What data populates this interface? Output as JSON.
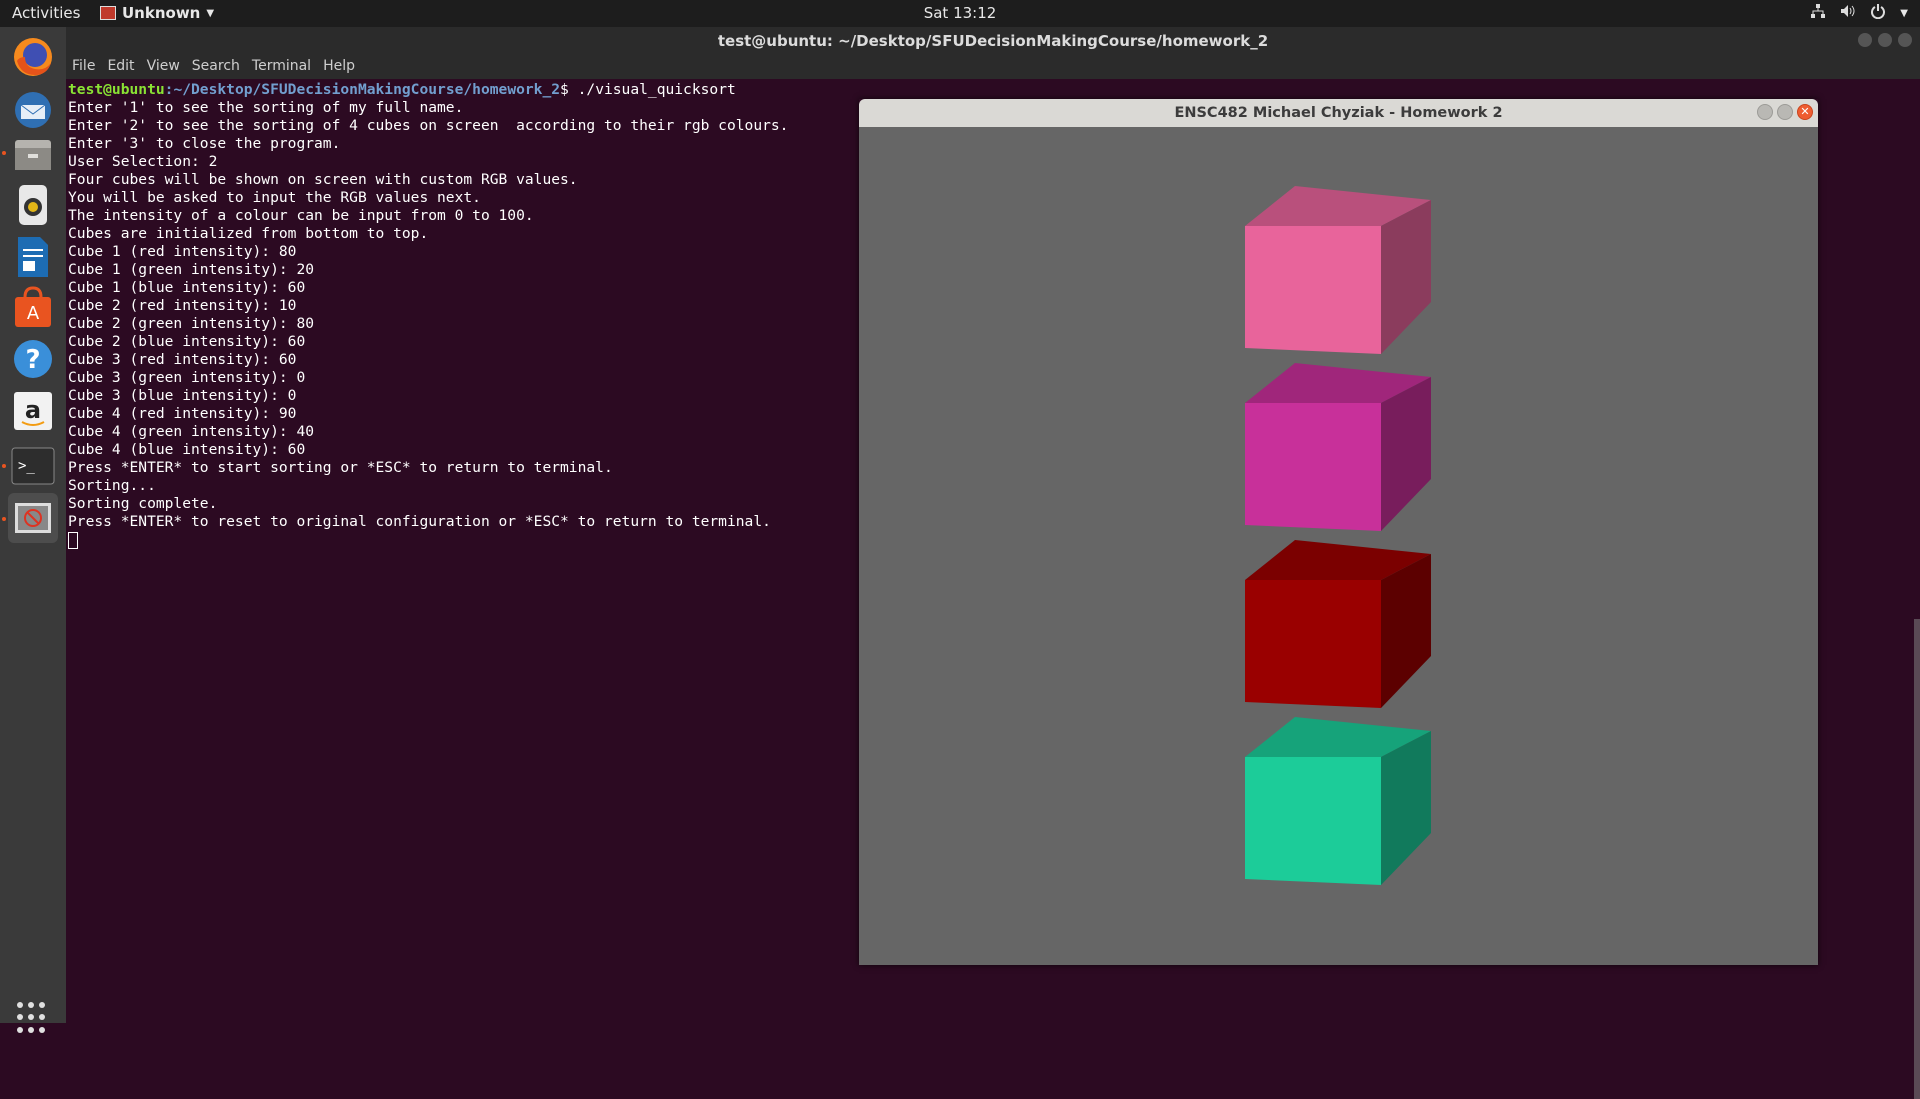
{
  "topbar": {
    "activities": "Activities",
    "app_menu": "Unknown",
    "clock": "Sat 13:12",
    "tray_icons": [
      "network-icon",
      "volume-icon",
      "power-icon"
    ]
  },
  "dock": {
    "items": [
      "firefox-icon",
      "thunderbird-icon",
      "files-icon",
      "rhythmbox-icon",
      "writer-icon",
      "software-icon",
      "help-icon",
      "amazon-icon",
      "terminal-icon",
      "app-icon"
    ]
  },
  "terminal": {
    "title": "test@ubuntu: ~/Desktop/SFUDecisionMakingCourse/homework_2",
    "menu": [
      "File",
      "Edit",
      "View",
      "Search",
      "Terminal",
      "Help"
    ],
    "prompt_user": "test@ubuntu",
    "prompt_path": ":~/Desktop/SFUDecisionMakingCourse/homework_2",
    "command": "$ ./visual_quicksort",
    "lines": [
      "Enter '1' to see the sorting of my full name.",
      "Enter '2' to see the sorting of 4 cubes on screen  according to their rgb colours.",
      "Enter '3' to close the program.",
      "User Selection: 2",
      "Four cubes will be shown on screen with custom RGB values.",
      "You will be asked to input the RGB values next.",
      "The intensity of a colour can be input from 0 to 100.",
      "Cubes are initialized from bottom to top.",
      "Cube 1 (red intensity): 80",
      "Cube 1 (green intensity): 20",
      "Cube 1 (blue intensity): 60",
      "Cube 2 (red intensity): 10",
      "Cube 2 (green intensity): 80",
      "Cube 2 (blue intensity): 60",
      "Cube 3 (red intensity): 60",
      "Cube 3 (green intensity): 0",
      "Cube 3 (blue intensity): 0",
      "Cube 4 (red intensity): 90",
      "Cube 4 (green intensity): 40",
      "Cube 4 (blue intensity): 60",
      "Press *ENTER* to start sorting or *ESC* to return to terminal.",
      "Sorting...",
      "Sorting complete.",
      "Press *ENTER* to reset to original configuration or *ESC* to return to terminal."
    ]
  },
  "gl_window": {
    "title": "ENSC482 Michael Chyziak - Homework 2",
    "background": "#666666",
    "cubes": [
      {
        "front": "#e8649b",
        "top": "#b9507c",
        "side": "#8b3c5d"
      },
      {
        "front": "#c8309a",
        "top": "#a0267b",
        "side": "#781d5c"
      },
      {
        "front": "#9a0000",
        "top": "#7b0000",
        "side": "#5c0000"
      },
      {
        "front": "#1ccc99",
        "top": "#16a37a",
        "side": "#117a5c"
      }
    ]
  }
}
